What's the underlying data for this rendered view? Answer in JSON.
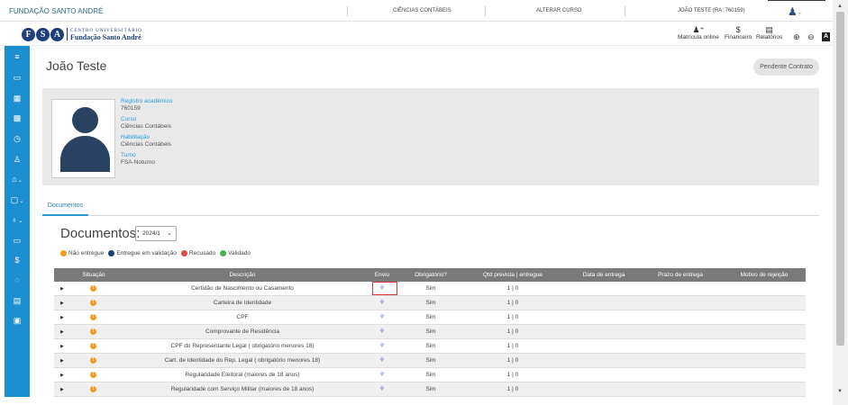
{
  "topbar": {
    "brand": "FUNDAÇÃO SANTO ANDRÉ",
    "course": "CIÊNCIAS CONTÁBEIS",
    "change_course": "ALTERAR CURSO",
    "user": "JOÃO TESTE (RA: 760159)"
  },
  "logo": {
    "letters": [
      "F",
      "S",
      "A"
    ],
    "line1": "CENTRO UNIVERSITÁRIO",
    "line2": "Fundação Santo André"
  },
  "header": {
    "items": [
      {
        "icon": "user-plus-icon",
        "glyph": "⁺",
        "label": "Matrícula online"
      },
      {
        "icon": "dollar-icon",
        "glyph": "$",
        "label": "Financeiro"
      },
      {
        "icon": "report-icon",
        "glyph": "🗎",
        "label": "Relatórios"
      }
    ]
  },
  "sidebar": {
    "items": [
      {
        "icon": "menu-icon",
        "glyph": "≡"
      },
      {
        "icon": "monitor-icon",
        "glyph": "▭"
      },
      {
        "icon": "calendar-icon",
        "glyph": "▦"
      },
      {
        "icon": "grid-icon",
        "glyph": "▩"
      },
      {
        "icon": "clock-icon",
        "glyph": "◷"
      },
      {
        "icon": "user-add-icon",
        "glyph": "♙"
      },
      {
        "icon": "graduation-icon",
        "glyph": "⌂",
        "caret": true
      },
      {
        "icon": "clipboard-icon",
        "glyph": "▢",
        "caret": true
      },
      {
        "icon": "pin-icon",
        "glyph": "♁",
        "caret": true
      },
      {
        "icon": "inbox-icon",
        "glyph": "▭"
      },
      {
        "icon": "dollar-icon",
        "glyph": "$"
      },
      {
        "icon": "chat-icon",
        "glyph": "◌"
      },
      {
        "icon": "document-icon",
        "glyph": "▤"
      },
      {
        "icon": "window-icon",
        "glyph": "▣"
      }
    ]
  },
  "student": {
    "name": "João Teste",
    "status_button": "Pendente Contrato",
    "fields": [
      {
        "label": "Registro acadêmico",
        "value": "760159"
      },
      {
        "label": "Curso",
        "value": "Ciências Contábeis"
      },
      {
        "label": "Habilitação",
        "value": "Ciências Contábeis"
      },
      {
        "label": "Turno",
        "value": "FSA-Noturno"
      }
    ]
  },
  "tabs": {
    "documents": "Documentos"
  },
  "documents": {
    "title": "Documentos:",
    "year": "2024/1",
    "legend": [
      {
        "label": "Não entregue",
        "color": "#f29a23"
      },
      {
        "label": "Entregue em validação",
        "color": "#1d3e78"
      },
      {
        "label": "Recusado",
        "color": "#e04848"
      },
      {
        "label": "Validado",
        "color": "#4caf50"
      }
    ],
    "columns": [
      "Situação",
      "Descrição",
      "Envio",
      "Obrigatório?",
      "Qtd prevista | entregue",
      "Data de entrega",
      "Prazo de entrega",
      "Motivo de rejeição"
    ],
    "rows": [
      {
        "desc": "Certidão de Nascimento ou Casamento",
        "required": "Sim",
        "qty": "1 | 0"
      },
      {
        "desc": "Carteira de Identidade",
        "required": "Sim",
        "qty": "1 | 0"
      },
      {
        "desc": "CPF",
        "required": "Sim",
        "qty": "1 | 0"
      },
      {
        "desc": "Comprovante de Residência",
        "required": "Sim",
        "qty": "1 | 0"
      },
      {
        "desc": "CPF do Representante Legal ( obrigatório menores 18)",
        "required": "Sim",
        "qty": "1 | 0"
      },
      {
        "desc": "Cart. de Identidade do Rep. Legal ( obrigatório menores 18)",
        "required": "Sim",
        "qty": "1 | 0"
      },
      {
        "desc": "Regularidade Eleitoral (maiores de 18 anos)",
        "required": "Sim",
        "qty": "1 | 0"
      },
      {
        "desc": "Regularidade com Serviço Militar (maiores de 18 anos)",
        "required": "Sim",
        "qty": "1 | 0"
      }
    ]
  }
}
